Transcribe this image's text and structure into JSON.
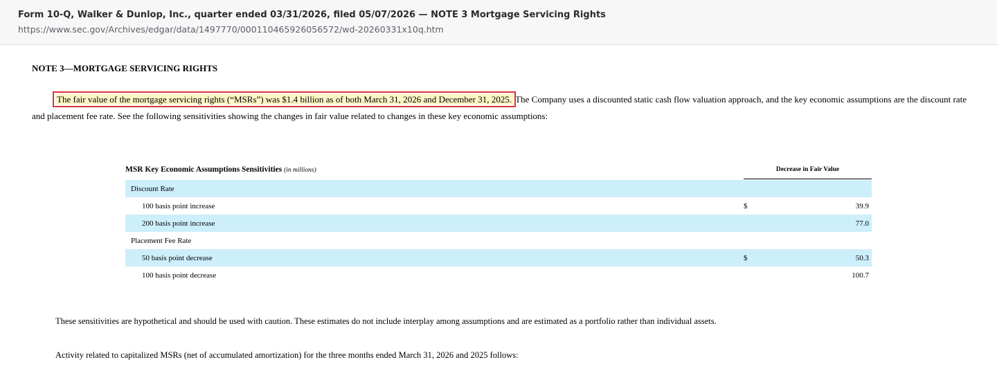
{
  "header": {
    "title": "Form 10-Q, Walker & Dunlop, Inc., quarter ended 03/31/2026, filed 05/07/2026 — NOTE 3 Mortgage Servicing Rights",
    "url": "https://www.sec.gov/Archives/edgar/data/1497770/000110465926056572/wd-20260331x10q.htm"
  },
  "note": {
    "heading": "NOTE 3—MORTGAGE SERVICING RIGHTS",
    "highlighted_sentence": "The fair value of the mortgage servicing rights (“MSRs”) was $1.4 billion as of both March 31, 2026 and December 31, 2025.",
    "rest_of_paragraph": "The Company uses a discounted static cash flow valuation approach, and the key economic assumptions are the discount rate and placement fee rate. See the following sensitivities showing the changes in fair value related to changes in these key economic assumptions:"
  },
  "table": {
    "title": "MSR Key Economic Assumptions Sensitivities",
    "unit": "(in millions)",
    "column_header": "Decrease in Fair Value",
    "rows": [
      {
        "label": "Discount Rate",
        "currency": "",
        "value": ""
      },
      {
        "label": "100 basis point increase",
        "currency": "$",
        "value": "39.9"
      },
      {
        "label": "200 basis point increase",
        "currency": "",
        "value": "77.0"
      },
      {
        "label": "Placement Fee Rate",
        "currency": "",
        "value": ""
      },
      {
        "label": "50 basis point decrease",
        "currency": "$",
        "value": "50.3"
      },
      {
        "label": "100 basis point decrease",
        "currency": "",
        "value": "100.7"
      }
    ]
  },
  "footer_text": {
    "caution": "These sensitivities are hypothetical and should be used with caution. These estimates do not include interplay among assumptions and are estimated as a portfolio rather than individual assets.",
    "activity": "Activity related to capitalized MSRs (net of accumulated amortization) for the three months ended March 31, 2026 and 2025 follows:"
  },
  "colors": {
    "highlight_fill": "#fdf5c4",
    "highlight_border": "#d9343a",
    "row_shade": "#cdeefb"
  }
}
